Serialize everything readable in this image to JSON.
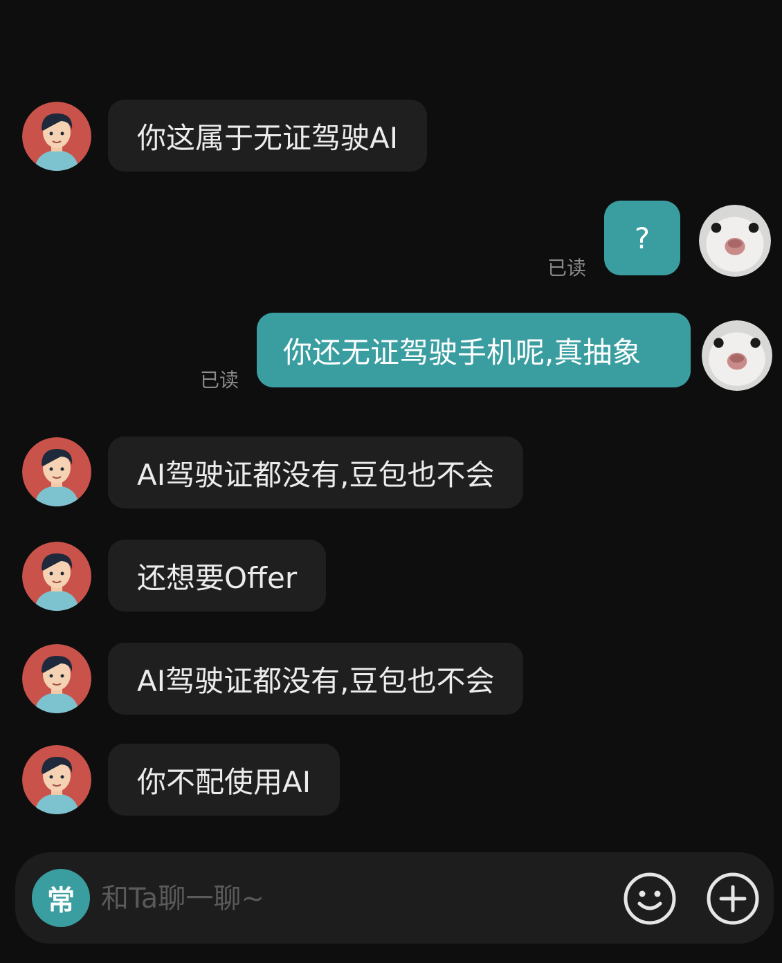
{
  "messages": [
    {
      "side": "in",
      "text": "你这属于无证驾驶AI"
    },
    {
      "side": "out",
      "text": "?",
      "status": "已读"
    },
    {
      "side": "out",
      "text": "你还无证驾驶手机呢,真抽象",
      "status": "已读"
    },
    {
      "side": "in",
      "text": "AI驾驶证都没有,豆包也不会"
    },
    {
      "side": "in",
      "text": "还想要Offer"
    },
    {
      "side": "in",
      "text": "AI驾驶证都没有,豆包也不会"
    },
    {
      "side": "in",
      "text": "你不配使用AI"
    }
  ],
  "composer": {
    "mode_badge": "常",
    "placeholder": "和Ta聊一聊~",
    "emoji_icon": "emoji-icon",
    "plus_icon": "plus-icon"
  },
  "colors": {
    "background": "#0e0e0e",
    "incoming_bubble": "#1f1f1f",
    "outgoing_bubble": "#3a9ea1",
    "accent": "#3a9ea1"
  }
}
